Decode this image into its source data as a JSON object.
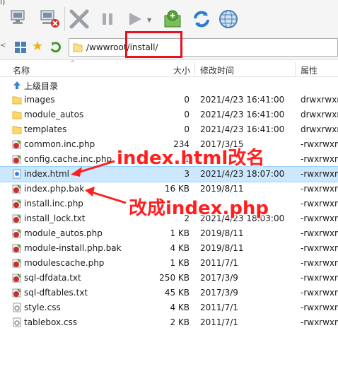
{
  "window": {
    "title_fragment": "l)"
  },
  "address": {
    "path": "/wwwroot/install/"
  },
  "columns": {
    "name": "名称",
    "size": "大小",
    "modified": "修改时间",
    "perm": "属性"
  },
  "files": [
    {
      "name": "上级目录",
      "size": "",
      "date": "",
      "perm": "",
      "kind": "up"
    },
    {
      "name": "images",
      "size": "0",
      "date": "2021/4/23 16:41:00",
      "perm": "drwxrwxrw",
      "kind": "folder"
    },
    {
      "name": "module_autos",
      "size": "0",
      "date": "2021/4/23 16:41:00",
      "perm": "drwxrwxrw",
      "kind": "folder"
    },
    {
      "name": "templates",
      "size": "0",
      "date": "2021/4/23 16:41:00",
      "perm": "drwxrwxrw",
      "kind": "folder"
    },
    {
      "name": "common.inc.php",
      "size": "234",
      "date": "2017/3/15",
      "perm": "-rwxrwxrw",
      "kind": "php"
    },
    {
      "name": "config.cache.inc.php",
      "size": "1",
      "date": "",
      "perm": "-rwxrwxrw",
      "kind": "php"
    },
    {
      "name": "index.html",
      "size": "3",
      "date": "2021/4/23 18:07:00",
      "perm": "-rwxrwxrw",
      "kind": "html"
    },
    {
      "name": "index.php.bak",
      "size": "16 KB",
      "date": "2019/8/11",
      "perm": "-rwxrwxrw",
      "kind": "php"
    },
    {
      "name": "install.inc.php",
      "size": "",
      "date": "",
      "perm": "-rwxrwxrw",
      "kind": "php"
    },
    {
      "name": "install_lock.txt",
      "size": "2",
      "date": "2021/4/23 18:03:00",
      "perm": "-rwxrwxrw",
      "kind": "php"
    },
    {
      "name": "module_autos.php",
      "size": "1 KB",
      "date": "2019/8/11",
      "perm": "-rwxrwxrw",
      "kind": "php"
    },
    {
      "name": "module-install.php.bak",
      "size": "4 KB",
      "date": "2019/8/11",
      "perm": "-rwxrwxrw",
      "kind": "php"
    },
    {
      "name": "modulescache.php",
      "size": "1 KB",
      "date": "2011/7/1",
      "perm": "-rwxrwxrw",
      "kind": "php"
    },
    {
      "name": "sql-dfdata.txt",
      "size": "250 KB",
      "date": "2017/3/9",
      "perm": "-rwxrwxrw",
      "kind": "php"
    },
    {
      "name": "sql-dftables.txt",
      "size": "45 KB",
      "date": "2017/3/9",
      "perm": "-rwxrwxrw",
      "kind": "php"
    },
    {
      "name": "style.css",
      "size": "4 KB",
      "date": "2011/7/1",
      "perm": "-rwxrwxrw",
      "kind": "css"
    },
    {
      "name": "tablebox.css",
      "size": "2 KB",
      "date": "2011/7/1",
      "perm": "-rwxrwxrw",
      "kind": "css"
    }
  ],
  "annotations": {
    "a1": "index.html改名",
    "a2": "改成index.php"
  },
  "colors": {
    "annotation_red": "#ff1f1f",
    "selection": "#cce8ff"
  }
}
